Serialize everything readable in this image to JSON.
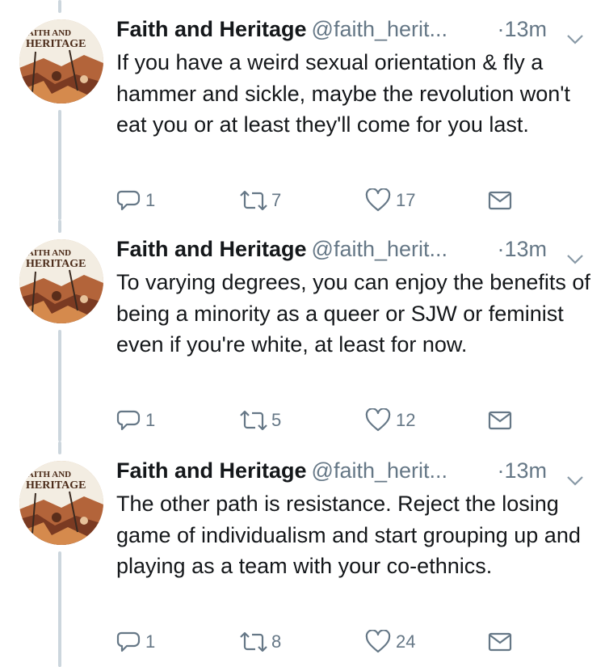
{
  "tweets": [
    {
      "author": "Faith and Heritage",
      "handle": "@faith_herit...",
      "time": "·13m",
      "text": "If you have a weird sexual orientation & fly a hammer and sickle, maybe the revolution won't eat you or at least they'll come for you last.",
      "replies": "1",
      "retweets": "7",
      "likes": "17"
    },
    {
      "author": "Faith and Heritage",
      "handle": "@faith_herit...",
      "time": "·13m",
      "text": "To varying degrees, you can enjoy the benefits of being a minority as a queer or SJW or feminist even if you're white, at least for now.",
      "replies": "1",
      "retweets": "5",
      "likes": "12"
    },
    {
      "author": "Faith and Heritage",
      "handle": "@faith_herit...",
      "time": "·13m",
      "text": "The other path is resistance. Reject the losing game of individualism and start grouping up and playing as a team with your co-ethnics.",
      "replies": "1",
      "retweets": "8",
      "likes": "24"
    }
  ],
  "avatar": {
    "top_text": "AITH AND",
    "bottom_text": "HERITAGE"
  },
  "icons": {
    "reply": "reply-icon",
    "retweet": "retweet-icon",
    "like": "heart-icon",
    "dm": "envelope-icon",
    "caret": "chevron-down-icon"
  },
  "colors": {
    "text": "#14171a",
    "secondary": "#657786",
    "thread_line": "#ccd6dd"
  }
}
